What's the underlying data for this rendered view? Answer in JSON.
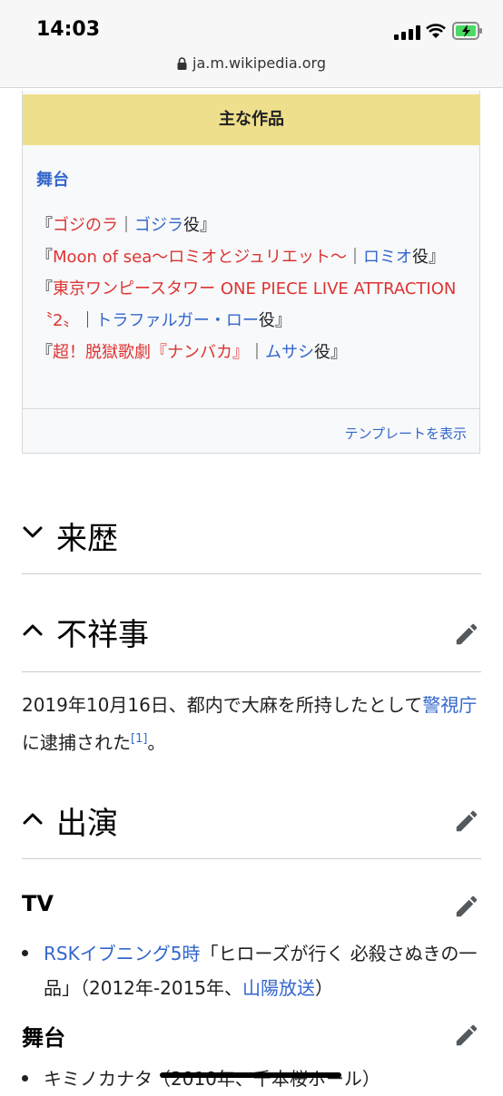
{
  "status_bar": {
    "time": "14:03"
  },
  "browser": {
    "url": "ja.m.wikipedia.org"
  },
  "infobox": {
    "header": "主な作品",
    "subheader": "舞台",
    "works": [
      {
        "open": "『",
        "title": "ゴジのラ",
        "sep": "｜",
        "role": "ゴジラ",
        "suffix": "役』"
      },
      {
        "open": "『",
        "title": "Moon of sea〜ロミオとジュリエット〜",
        "sep": "｜",
        "role": "ロミオ",
        "suffix": "役』"
      },
      {
        "open": "『",
        "title": "東京ワンピースタワー ONE PIECE LIVE ATTRACTION〝2〟",
        "sep": "｜",
        "role": "トラファルガー・ロー",
        "suffix": "役』"
      },
      {
        "open": "『",
        "title": "超！脱獄歌劇『ナンバカ』",
        "sep": "｜",
        "role": "ムサシ",
        "suffix": "役』"
      }
    ],
    "footer_link": "テンプレートを表示"
  },
  "sections": {
    "history": {
      "title": "来歴"
    },
    "scandal": {
      "title": "不祥事",
      "text_1": "2019年10月16日、都内で大麻を所持したとして",
      "link_1": "警視庁",
      "text_2": "に逮捕された",
      "ref": "[1]",
      "text_3": "。"
    },
    "appearances": {
      "title": "出演",
      "tv": {
        "heading": "TV",
        "item_link": "RSKイブニング5時",
        "item_text": "「ヒローズが行く 必殺さぬきの一品」（2012年-2015年、",
        "item_link_2": "山陽放送",
        "item_close": "）"
      },
      "stage": {
        "heading": "舞台",
        "item_text": "キミノカナタ（2010年、千本桜ホール）"
      }
    }
  }
}
